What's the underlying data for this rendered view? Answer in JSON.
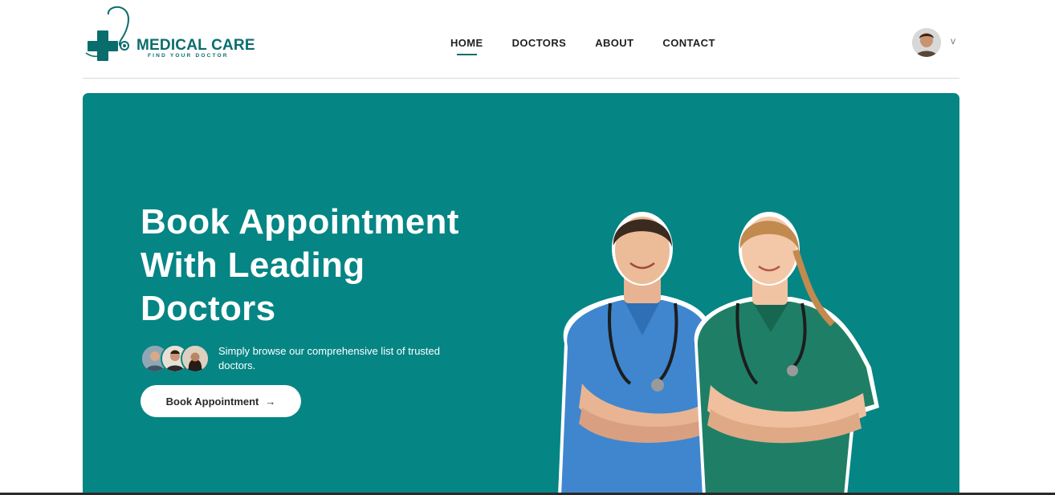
{
  "brand": {
    "title": "MEDICAL CARE",
    "tagline": "FIND YOUR DOCTOR",
    "accent": "#0a6d6d",
    "hero_bg": "#068585"
  },
  "nav": {
    "items": [
      {
        "label": "HOME",
        "active": true
      },
      {
        "label": "DOCTORS",
        "active": false
      },
      {
        "label": "ABOUT",
        "active": false
      },
      {
        "label": "CONTACT",
        "active": false
      }
    ]
  },
  "profile": {
    "chevron": "v"
  },
  "hero": {
    "title_lines": [
      "Book Appointment",
      "With Leading",
      "Doctors"
    ],
    "subtitle": "Simply browse our comprehensive list of trusted doctors.",
    "button_label": "Book Appointment",
    "button_icon": "→"
  },
  "icons": {
    "logo": "medical-cross-stethoscope-icon",
    "profile": "user-avatar",
    "arrow": "arrow-right-icon"
  }
}
